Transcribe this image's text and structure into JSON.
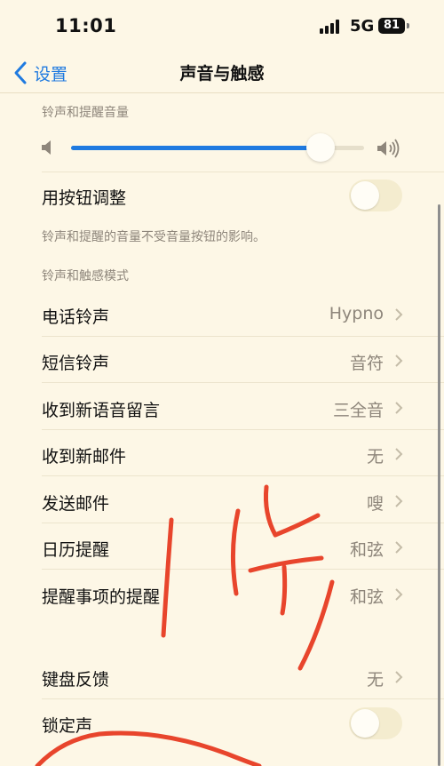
{
  "status_bar": {
    "time": "11:01",
    "network": "5G",
    "battery": "81"
  },
  "nav": {
    "back_label": "设置",
    "title": "声音与触感"
  },
  "ringer_section": {
    "header": "铃声和提醒音量",
    "volume_level": 0.85,
    "change_with_buttons_label": "用按钮调整",
    "change_with_buttons_on": false,
    "footnote": "铃声和提醒的音量不受音量按钮的影响。"
  },
  "patterns_section": {
    "header": "铃声和触感模式",
    "items": [
      {
        "label": "电话铃声",
        "value": "Hypno"
      },
      {
        "label": "短信铃声",
        "value": "音符"
      },
      {
        "label": "收到新语音留言",
        "value": "三全音"
      },
      {
        "label": "收到新邮件",
        "value": "无"
      },
      {
        "label": "发送邮件",
        "value": "嗖"
      },
      {
        "label": "日历提醒",
        "value": "和弦"
      },
      {
        "label": "提醒事项的提醒",
        "value": "和弦"
      }
    ]
  },
  "system_section": {
    "keyboard_feedback_label": "键盘反馈",
    "keyboard_feedback_value": "无",
    "lock_sound_label": "锁定声",
    "lock_sound_on": false
  },
  "colors": {
    "accent": "#1f7ae0",
    "background": "#fdf7e6",
    "secondary_text": "#8e867b",
    "ink": "#e8452c"
  }
}
